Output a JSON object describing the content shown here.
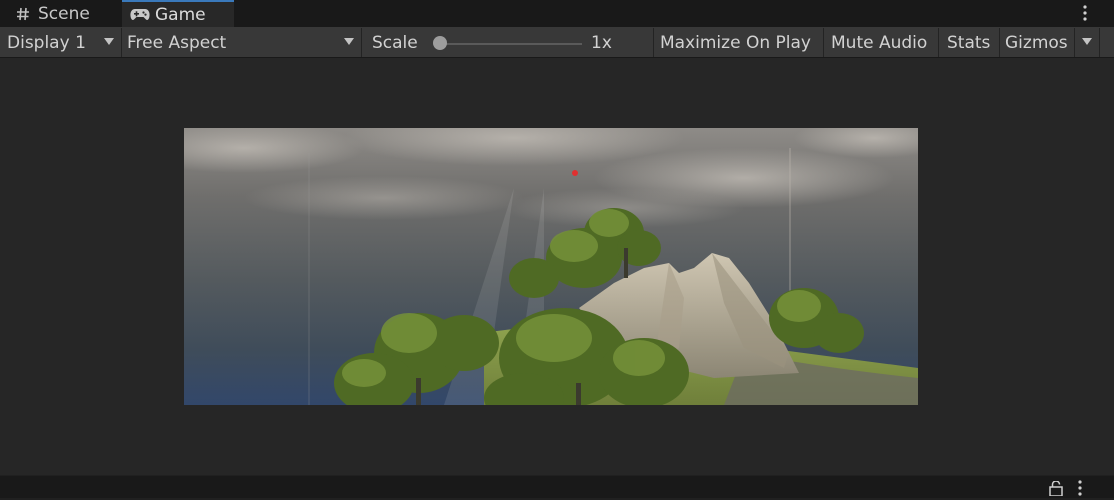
{
  "tabs": [
    {
      "label": "Scene",
      "icon": "hash-icon",
      "active": false
    },
    {
      "label": "Game",
      "icon": "gamepad-icon",
      "active": true
    }
  ],
  "toolbar": {
    "display": "Display 1",
    "aspect": "Free Aspect",
    "scale_label": "Scale",
    "scale_value": "1x",
    "scale_level": 0,
    "maximize_on_play": "Maximize On Play",
    "mute_audio": "Mute Audio",
    "stats": "Stats",
    "gizmos": "Gizmos"
  },
  "colors": {
    "accent_tab": "#3a79bb",
    "panel": "#383838",
    "background": "#262626"
  }
}
